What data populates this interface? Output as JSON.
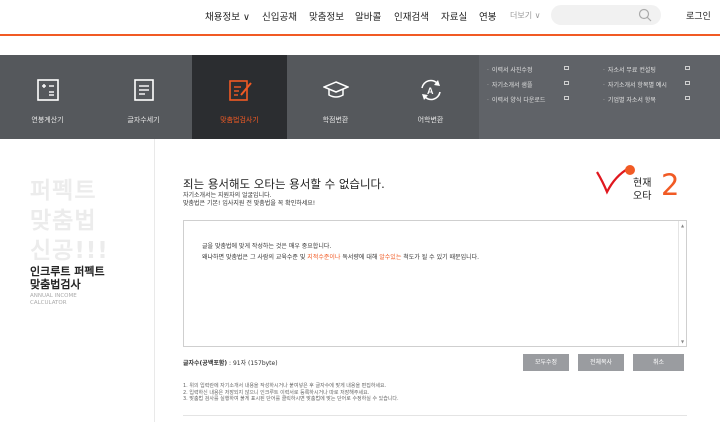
{
  "nav": {
    "menu": [
      "채용정보 ∨",
      "신입공채",
      "맞춤정보",
      "알바콜",
      "인재검색",
      "자료실",
      "연봉"
    ],
    "more": "더보기 ∨",
    "login": "로그인"
  },
  "tools": [
    {
      "label": "연봉계산기",
      "icon": "calculator-icon"
    },
    {
      "label": "글자수세기",
      "icon": "document-icon"
    },
    {
      "label": "맞춤법검사기",
      "icon": "edit-icon",
      "active": true
    },
    {
      "label": "학점변환",
      "icon": "graduation-cap-icon"
    },
    {
      "label": "어학변환",
      "icon": "language-convert-icon"
    }
  ],
  "quick_links": {
    "col1": [
      "이력서 사진수정",
      "자기소개서 샘플",
      "이력서 양식 다운로드"
    ],
    "col2": [
      "자소서 무료 컨설팅",
      "자기소개서 항목별 예시",
      "기업별 자소서 항목"
    ]
  },
  "sidebar": {
    "big": [
      "퍼펙트",
      "맞춤법",
      "신공!!!"
    ],
    "title": [
      "인크루트 퍼펙트",
      "맞춤법검사"
    ],
    "sub": [
      "ANNUAL INCOME",
      "CALCULATOR"
    ]
  },
  "main": {
    "title": "죄는 용서해도 오타는 용서할 수 없습니다.",
    "desc1": "자기소개서는 지원자의 얼굴입니다.",
    "desc2": "맞춤법은 기본! 입사지원 전 맞춤법을 꼭 확인하세요!",
    "status_line1": "현재",
    "status_line2": "오타",
    "status_count": "2",
    "editor": {
      "line1": "글을 맞춤법에 맞게 작성하는 것은 매우 중요합니다.",
      "line2_a": "왜냐하면 맞춤법은 그 사람의 교육수준 및 ",
      "line2_h1": "지적수준이나",
      "line2_b": " 독서량에 대해 ",
      "line2_h2": "알수있는",
      "line2_c": " 척도가 될 수 있기 때문입니다."
    },
    "count_label": "글자수(공백포함)",
    "count_value": " : 91자 (157byte)",
    "buttons": [
      "모두수정",
      "전체복사",
      "취소"
    ],
    "notes": [
      "1. 위의 입력란에 자기소개서 내용을 작성하시거나 붙여넣은 후 글자수에 맞게 내용을 편집하세요.",
      "2. 입력하신 내용은 저장되지 않으니 인크루트 이력서로 등록하시거나 따로 저장해주세요.",
      "3. 맞춤법 검사를 실행하여 붉게 표시된 단어를 클릭하시면 맞춤법에 맞는 단어로 수정하실 수 있습니다."
    ]
  }
}
